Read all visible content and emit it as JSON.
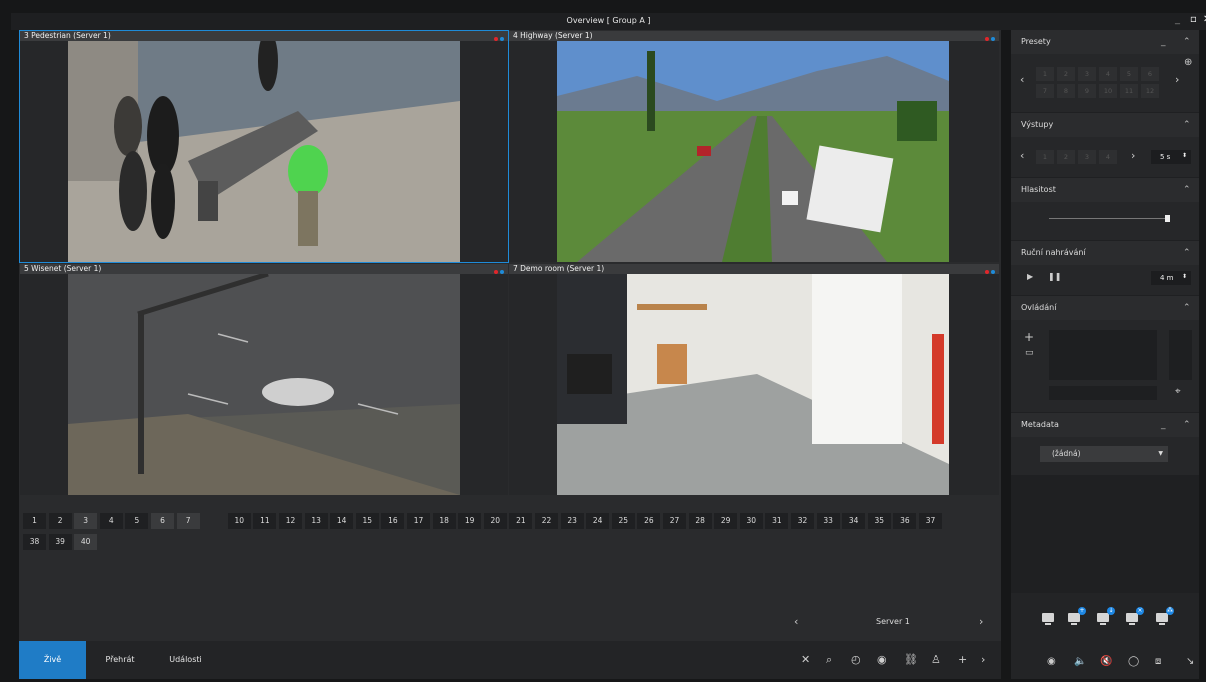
{
  "window": {
    "title": "Overview  [ Group A ]",
    "minimize": "_",
    "maximize": "▫",
    "close": "✕"
  },
  "tiles": [
    {
      "label": "3  Pedestrian (Server 1)",
      "active": true
    },
    {
      "label": "4  Highway (Server 1)",
      "active": false
    },
    {
      "label": "5  Wisenet (Server 1)",
      "active": false
    },
    {
      "label": "7  Demo room (Server 1)",
      "active": false
    }
  ],
  "layout_numbers": [
    "1",
    "2",
    "3",
    "4",
    "5",
    "6",
    "7",
    "",
    "10",
    "11",
    "12",
    "13",
    "14",
    "15",
    "16",
    "17",
    "18",
    "19",
    "20",
    "21",
    "22",
    "23",
    "24",
    "25",
    "26",
    "27",
    "28",
    "29",
    "30",
    "31",
    "32",
    "33",
    "34",
    "35",
    "36",
    "37",
    "38",
    "39",
    "40"
  ],
  "lit_numbers": [
    "3",
    "6",
    "7",
    "40"
  ],
  "server_nav": {
    "prev": "‹",
    "label": "Server 1",
    "next": "›"
  },
  "tabs": [
    {
      "label": "Živě",
      "active": true
    },
    {
      "label": "Přehrát",
      "active": false
    },
    {
      "label": "Události",
      "active": false
    }
  ],
  "toolbar_icons": [
    "close-icon",
    "search-icon",
    "clock-icon",
    "record-icon",
    "link-icon",
    "user-icon",
    "plus-icon",
    "chevron-right-icon"
  ],
  "panel": {
    "presets": {
      "title": "Presety",
      "cells": [
        "1",
        "2",
        "3",
        "4",
        "5",
        "6",
        "7",
        "8",
        "9",
        "10",
        "11",
        "12"
      ]
    },
    "outputs": {
      "title": "Výstupy",
      "cells": [
        "1",
        "2",
        "3",
        "4"
      ],
      "interval": "5 s"
    },
    "volume": {
      "title": "Hlasitost",
      "level": 0.98
    },
    "manual_recording": {
      "title": "Ruční nahrávání",
      "duration": "4 m"
    },
    "control": {
      "title": "Ovládání"
    },
    "metadata": {
      "title": "Metadata",
      "selected": "(žádná)"
    }
  },
  "colors": {
    "accent": "#1f7cc6",
    "dot_red": "#e0262b",
    "dot_blue": "#1f8bd8"
  }
}
